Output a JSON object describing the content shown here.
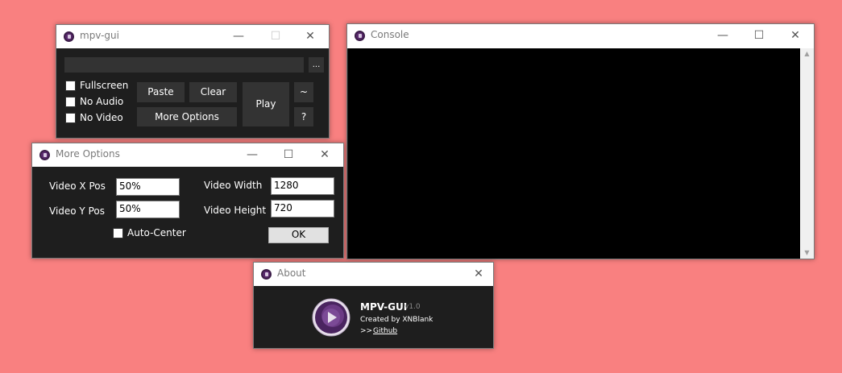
{
  "main_window": {
    "title": "mpv-gui",
    "browse_label": "...",
    "checkboxes": [
      "Fullscreen",
      "No Audio",
      "No Video"
    ],
    "paste_label": "Paste",
    "clear_label": "Clear",
    "more_options_label": "More Options",
    "play_label": "Play",
    "tilde_label": "~",
    "help_label": "?"
  },
  "console_window": {
    "title": "Console"
  },
  "more_options_window": {
    "title": "More Options",
    "video_x_label": "Video X Pos",
    "video_x_value": "50%",
    "video_y_label": "Video Y Pos",
    "video_y_value": "50%",
    "video_width_label": "Video Width",
    "video_width_value": "1280",
    "video_height_label": "Video Height",
    "video_height_value": "720",
    "auto_center_label": "Auto-Center",
    "ok_label": "OK"
  },
  "about_window": {
    "title": "About",
    "app_name": "MPV-GUI",
    "version": "v1.0",
    "created_by": "Created by XNBlank",
    "link_prefix": ">>",
    "link_text": "Github"
  },
  "colors": {
    "desktop": "#f98080",
    "panel": "#1e1e1e",
    "button": "#333333",
    "accent": "#5a2a6e"
  }
}
